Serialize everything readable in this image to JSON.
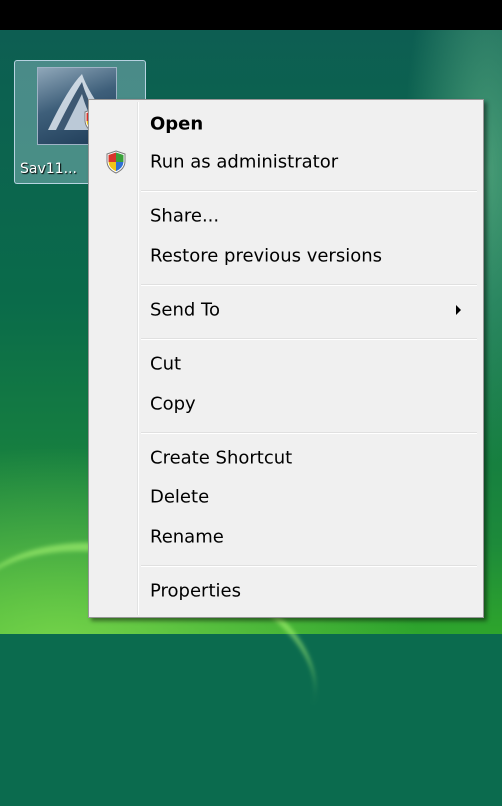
{
  "desktop": {
    "icon_label": "Sav11..."
  },
  "menu": {
    "open": "Open",
    "run_as_admin": "Run as administrator",
    "share": "Share...",
    "restore_previous": "Restore previous versions",
    "send_to": "Send To",
    "cut": "Cut",
    "copy": "Copy",
    "create_shortcut": "Create Shortcut",
    "delete": "Delete",
    "rename": "Rename",
    "properties": "Properties"
  },
  "icons": {
    "shield": "uac-shield-icon",
    "submenu": "submenu-arrow-icon",
    "app": "app-icon"
  }
}
